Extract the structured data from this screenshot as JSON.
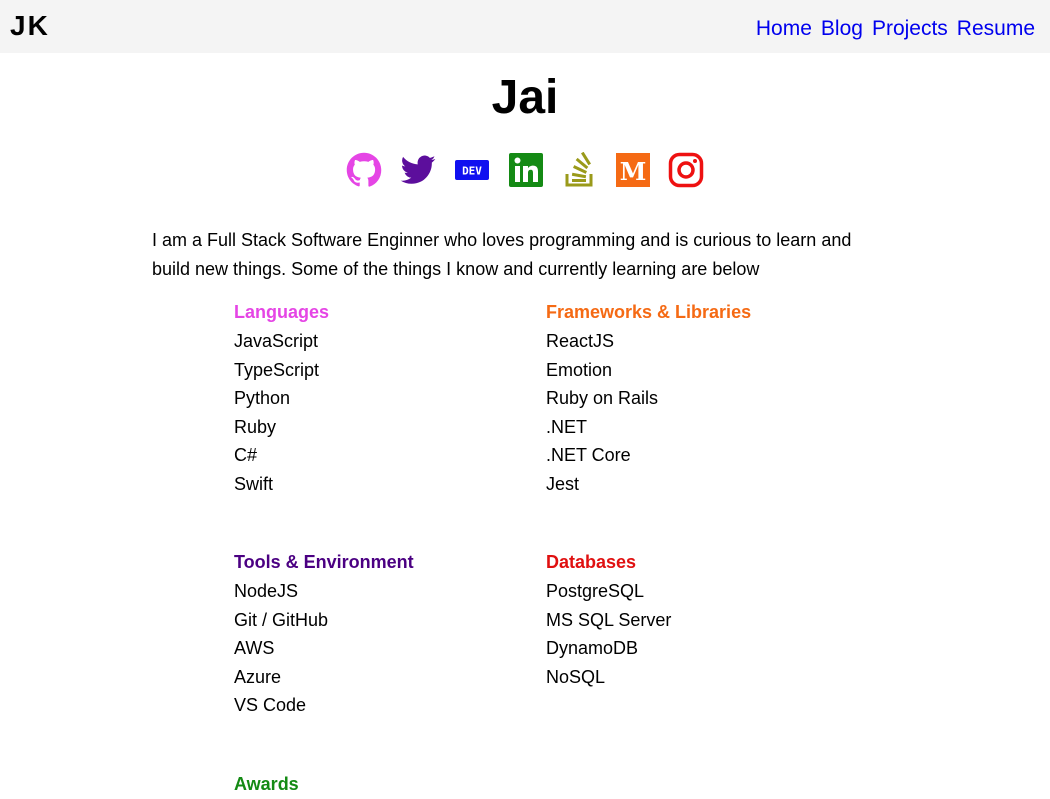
{
  "header": {
    "logo": "JK",
    "nav": [
      {
        "label": "Home"
      },
      {
        "label": "Blog"
      },
      {
        "label": "Projects"
      },
      {
        "label": "Resume"
      }
    ],
    "link_color": "#0000ee",
    "background": "#f4f4f4"
  },
  "profile": {
    "name": "Jai",
    "socials": [
      {
        "icon": "github-icon",
        "color": "#e545e5"
      },
      {
        "icon": "twitter-icon",
        "color": "#5c0e9c"
      },
      {
        "icon": "dev-icon",
        "color": "#1010f0",
        "text": "DEV"
      },
      {
        "icon": "linkedin-icon",
        "color": "#148a14"
      },
      {
        "icon": "stackoverflow-icon",
        "color": "#9a9a1a"
      },
      {
        "icon": "medium-icon",
        "color": "#f56a14",
        "text": "M"
      },
      {
        "icon": "instagram-icon",
        "color": "#ee1111"
      }
    ],
    "intro": "I am a Full Stack Software Enginner who loves programming and is curious to learn and build new things. Some of the things I know and currently learning are below"
  },
  "skills": {
    "languages": {
      "title": "Languages",
      "color": "#e545e5",
      "items": [
        "JavaScript",
        "TypeScript",
        "Python",
        "Ruby",
        "C#",
        "Swift"
      ]
    },
    "frameworks": {
      "title": "Frameworks & Libraries",
      "color": "#f56a14",
      "items": [
        "ReactJS",
        "Emotion",
        "Ruby on Rails",
        ".NET",
        ".NET Core",
        "Jest"
      ]
    },
    "tools": {
      "title": "Tools & Environment",
      "color": "#4b0082",
      "items": [
        "NodeJS",
        "Git / GitHub",
        "AWS",
        "Azure",
        "VS Code"
      ]
    },
    "databases": {
      "title": "Databases",
      "color": "#e01010",
      "items": [
        "PostgreSQL",
        "MS SQL Server",
        "DynamoDB",
        "NoSQL"
      ]
    },
    "awards": {
      "title": "Awards",
      "color": "#148a14"
    }
  }
}
